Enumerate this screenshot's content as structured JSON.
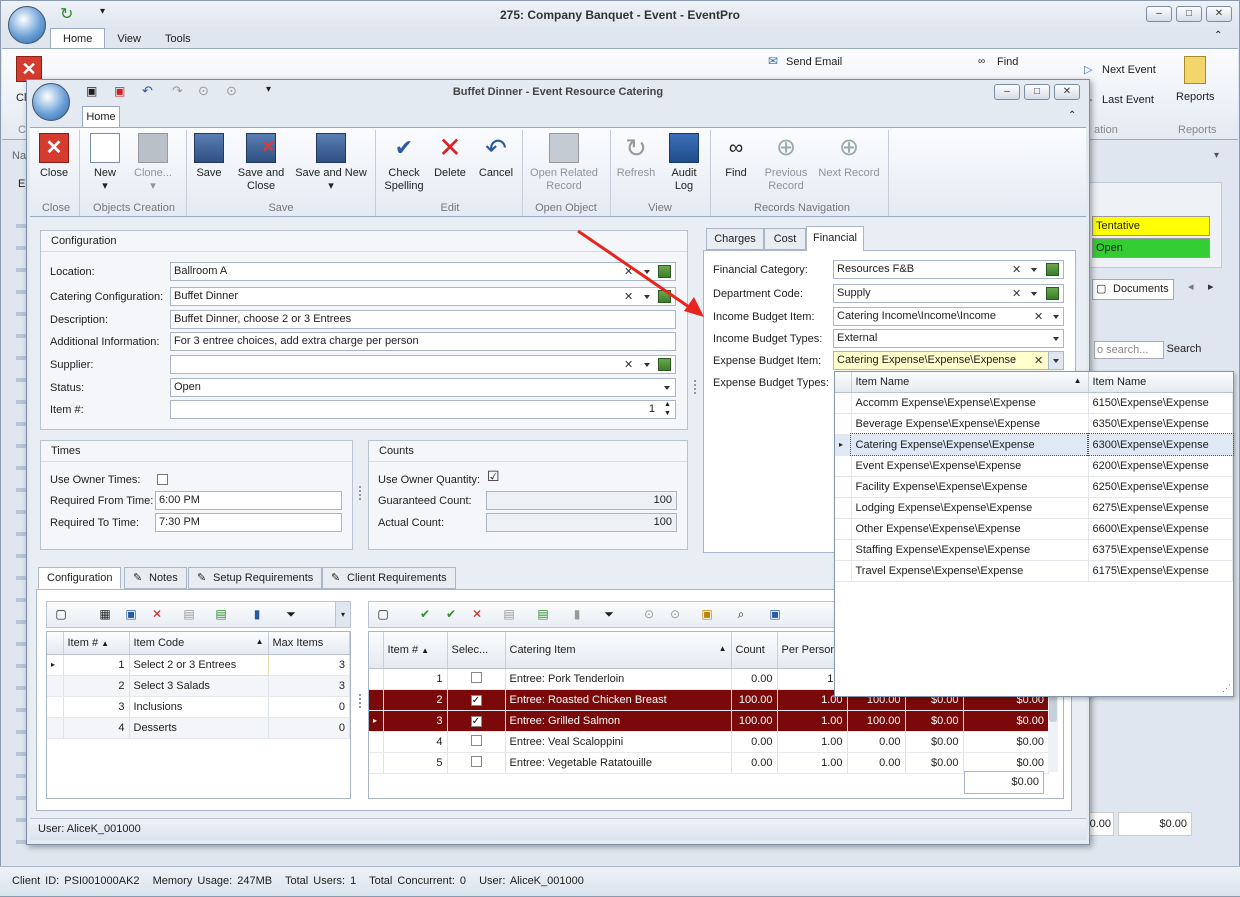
{
  "main_window": {
    "title": "275: Company Banquet - Event - EventPro",
    "tabs": [
      "Home",
      "View",
      "Tools"
    ],
    "ribbon_items": {
      "send_email": "Send Email",
      "find": "Find",
      "next_event": "Next Event",
      "last_event": "Last Event",
      "reports": "Reports",
      "reports_group": "Reports",
      "navigation_group": "ation",
      "close_partial": "Cl",
      "c_partial": "C",
      "na_partial": "Na",
      "e_partial": "E"
    },
    "right_status": {
      "tentative": "Tentative",
      "open": "Open",
      "documents": "Documents",
      "search_placeholder": "o search...",
      "search_button": "Search",
      "total_partial": "0.00",
      "total_right": "$0.00"
    },
    "colors": {
      "tentative": "#ffff00",
      "open": "#33cc33"
    }
  },
  "child_window": {
    "title": "Buffet Dinner - Event Resource Catering",
    "tab": "Home",
    "ribbon": {
      "close": "Close",
      "new": "New",
      "clone": "Clone...",
      "save": "Save",
      "save_and_close": [
        "Save and",
        "Close"
      ],
      "save_and_new": "Save and New",
      "check_spelling": [
        "Check",
        "Spelling"
      ],
      "delete": "Delete",
      "cancel": "Cancel",
      "open_related_record": [
        "Open Related",
        "Record"
      ],
      "refresh": "Refresh",
      "audit_log": [
        "Audit",
        "Log"
      ],
      "find": "Find",
      "previous_record": [
        "Previous",
        "Record"
      ],
      "next_record": "Next Record",
      "groups": {
        "close": "Close",
        "objects_creation": "Objects Creation",
        "save": "Save",
        "edit": "Edit",
        "open_object": "Open Object",
        "view": "View",
        "records_navigation": "Records Navigation"
      }
    },
    "configuration": {
      "header": "Configuration",
      "location_label": "Location:",
      "location": "Ballroom A",
      "catering_configuration_label": "Catering Configuration:",
      "catering_configuration": "Buffet Dinner",
      "description_label": "Description:",
      "description": "Buffet Dinner, choose 2 or 3 Entrees",
      "additional_information_label": "Additional Information:",
      "additional_information": "For 3 entree choices, add extra charge per person",
      "supplier_label": "Supplier:",
      "supplier": "",
      "status_label": "Status:",
      "status": "Open",
      "item_number_label": "Item #:",
      "item_number": "1"
    },
    "times": {
      "header": "Times",
      "use_owner_times_label": "Use Owner Times:",
      "use_owner_times": false,
      "required_from_label": "Required From Time:",
      "required_from": "6:00 PM",
      "required_to_label": "Required To Time:",
      "required_to": "7:30 PM"
    },
    "counts": {
      "header": "Counts",
      "use_owner_quantity_label": "Use Owner Quantity:",
      "use_owner_quantity": true,
      "guaranteed_label": "Guaranteed Count:",
      "guaranteed": "100",
      "actual_label": "Actual Count:",
      "actual": "100"
    },
    "financial_tabs": [
      "Charges",
      "Cost",
      "Financial"
    ],
    "financial": {
      "category_label": "Financial Category:",
      "category": "Resources F&B",
      "department_label": "Department Code:",
      "department": "Supply",
      "income_item_label": "Income Budget Item:",
      "income_item": "Catering Income\\Income\\Income",
      "income_types_label": "Income Budget Types:",
      "income_types": "External",
      "expense_item_label": "Expense Budget Item:",
      "expense_item": "Catering Expense\\Expense\\Expense",
      "expense_types_label": "Expense Budget Types:"
    },
    "expense_dropdown": {
      "columns": [
        "Item Name",
        "Item Name"
      ],
      "rows": [
        [
          "Accomm Expense\\Expense\\Expense",
          "6150\\Expense\\Expense"
        ],
        [
          "Beverage Expense\\Expense\\Expense",
          "6350\\Expense\\Expense"
        ],
        [
          "Catering Expense\\Expense\\Expense",
          "6300\\Expense\\Expense"
        ],
        [
          "Event Expense\\Expense\\Expense",
          "6200\\Expense\\Expense"
        ],
        [
          "Facility Expense\\Expense\\Expense",
          "6250\\Expense\\Expense"
        ],
        [
          "Lodging Expense\\Expense\\Expense",
          "6275\\Expense\\Expense"
        ],
        [
          "Other Expense\\Expense\\Expense",
          "6600\\Expense\\Expense"
        ],
        [
          "Staffing Expense\\Expense\\Expense",
          "6375\\Expense\\Expense"
        ],
        [
          "Travel Expense\\Expense\\Expense",
          "6175\\Expense\\Expense"
        ]
      ]
    },
    "bottom_tabs": [
      "Configuration",
      "Notes",
      "Setup Requirements",
      "Client Requirements"
    ],
    "config_grid": {
      "columns": [
        "Item #",
        "Item Code",
        "Max Items"
      ],
      "rows": [
        [
          "1",
          "Select 2 or 3 Entrees",
          "3"
        ],
        [
          "2",
          "Select 3 Salads",
          "3"
        ],
        [
          "3",
          "Inclusions",
          "0"
        ],
        [
          "4",
          "Desserts",
          "0"
        ]
      ]
    },
    "items_grid": {
      "columns": [
        "Item #",
        "Selec...",
        "Catering Item",
        "Count",
        "Per Person"
      ],
      "rows": [
        {
          "num": "1",
          "selected": false,
          "item": "Entree: Pork Tenderloin",
          "count": "0.00",
          "per": "1.0",
          "c6": "",
          "c7": "",
          "c8": ""
        },
        {
          "num": "2",
          "selected": true,
          "item": "Entree: Roasted Chicken Breast",
          "count": "100.00",
          "per": "1.00",
          "c6": "100.00",
          "c7": "$0.00",
          "c8": "$0.00"
        },
        {
          "num": "3",
          "selected": true,
          "item": "Entree: Grilled Salmon",
          "count": "100.00",
          "per": "1.00",
          "c6": "100.00",
          "c7": "$0.00",
          "c8": "$0.00"
        },
        {
          "num": "4",
          "selected": false,
          "item": "Entree: Veal Scaloppini",
          "count": "0.00",
          "per": "1.00",
          "c6": "0.00",
          "c7": "$0.00",
          "c8": "$0.00"
        },
        {
          "num": "5",
          "selected": false,
          "item": "Entree: Vegetable Ratatouille",
          "count": "0.00",
          "per": "1.00",
          "c6": "0.00",
          "c7": "$0.00",
          "c8": "$0.00"
        }
      ],
      "total": "$0.00"
    },
    "user_status": "User: AliceK_001000"
  },
  "status_bar": {
    "client_id": "Client ID: PSI001000AK2",
    "memory": "Memory Usage: 247MB",
    "total_users": "Total Users: 1",
    "total_concurrent": "Total Concurrent: 0",
    "user": "User: AliceK_001000"
  }
}
